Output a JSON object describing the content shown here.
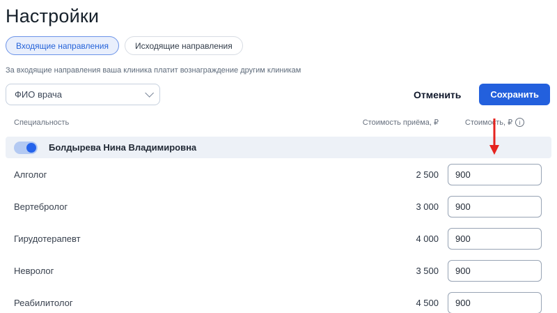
{
  "page": {
    "title": "Настройки"
  },
  "tabs": {
    "incoming": {
      "label": "Входящие направления",
      "active": true
    },
    "outgoing": {
      "label": "Исходящие направления",
      "active": false
    }
  },
  "description": "За входящие направления ваша клиника платит вознаграждение другим клиникам",
  "filter": {
    "doctor_select_value": "ФИО врача"
  },
  "actions": {
    "cancel_label": "Отменить",
    "save_label": "Сохранить"
  },
  "table": {
    "columns": {
      "specialty": "Специальность",
      "appointment_cost": "Стоимость приёма, ₽",
      "cost": "Стоимость, ₽"
    },
    "doctor": {
      "name": "Болдырева Нина Владимировна",
      "enabled": true
    },
    "rows": [
      {
        "specialty": "Алголог",
        "appointment_cost": "2 500",
        "cost": "900"
      },
      {
        "specialty": "Вертебролог",
        "appointment_cost": "3 000",
        "cost": "900"
      },
      {
        "specialty": "Гирудотерапевт",
        "appointment_cost": "4 000",
        "cost": "900"
      },
      {
        "specialty": "Невролог",
        "appointment_cost": "3 500",
        "cost": "900"
      },
      {
        "specialty": "Реабилитолог",
        "appointment_cost": "4 500",
        "cost": "900"
      }
    ]
  },
  "icons": {
    "info_glyph": "i",
    "dropdown_chevron": "chevron-down",
    "annotation": "red-arrow-down"
  },
  "colors": {
    "accent_blue": "#2360dd",
    "tab_active_bg": "#e9effc",
    "tab_active_border": "#6b93e8",
    "doctor_row_bg": "#edf1f7",
    "arrow_red": "#e5231f"
  }
}
